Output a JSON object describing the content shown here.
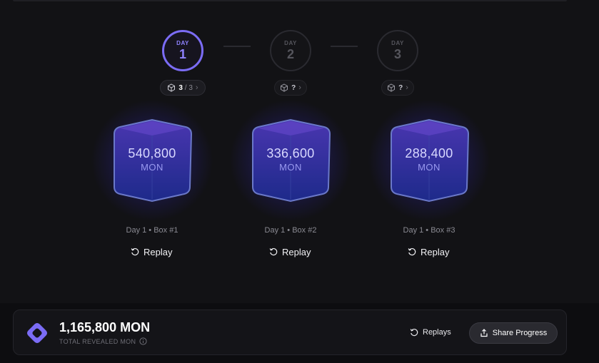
{
  "days": [
    {
      "label": "DAY",
      "number": "1",
      "state": "active",
      "count": "3",
      "sep": " / ",
      "total": "3"
    },
    {
      "label": "DAY",
      "number": "2",
      "state": "locked",
      "count": "?"
    },
    {
      "label": "DAY",
      "number": "3",
      "state": "locked",
      "count": "?"
    }
  ],
  "boxes": [
    {
      "amount": "540,800",
      "unit": "MON",
      "caption": "Day 1 • Box #1",
      "replay_label": "Replay"
    },
    {
      "amount": "336,600",
      "unit": "MON",
      "caption": "Day 1 • Box #2",
      "replay_label": "Replay"
    },
    {
      "amount": "288,400",
      "unit": "MON",
      "caption": "Day 1 • Box #3",
      "replay_label": "Replay"
    }
  ],
  "summary": {
    "total": "1,165,800 MON",
    "label": "TOTAL REVEALED MON",
    "replays_label": "Replays",
    "share_label": "Share Progress"
  },
  "colors": {
    "accent": "#7b6cf5",
    "background": "#0d0d10"
  },
  "icons": {
    "cube": "cube-icon",
    "replay": "replay-icon",
    "share": "share-icon",
    "info": "info-icon",
    "logo": "monad-logo"
  }
}
